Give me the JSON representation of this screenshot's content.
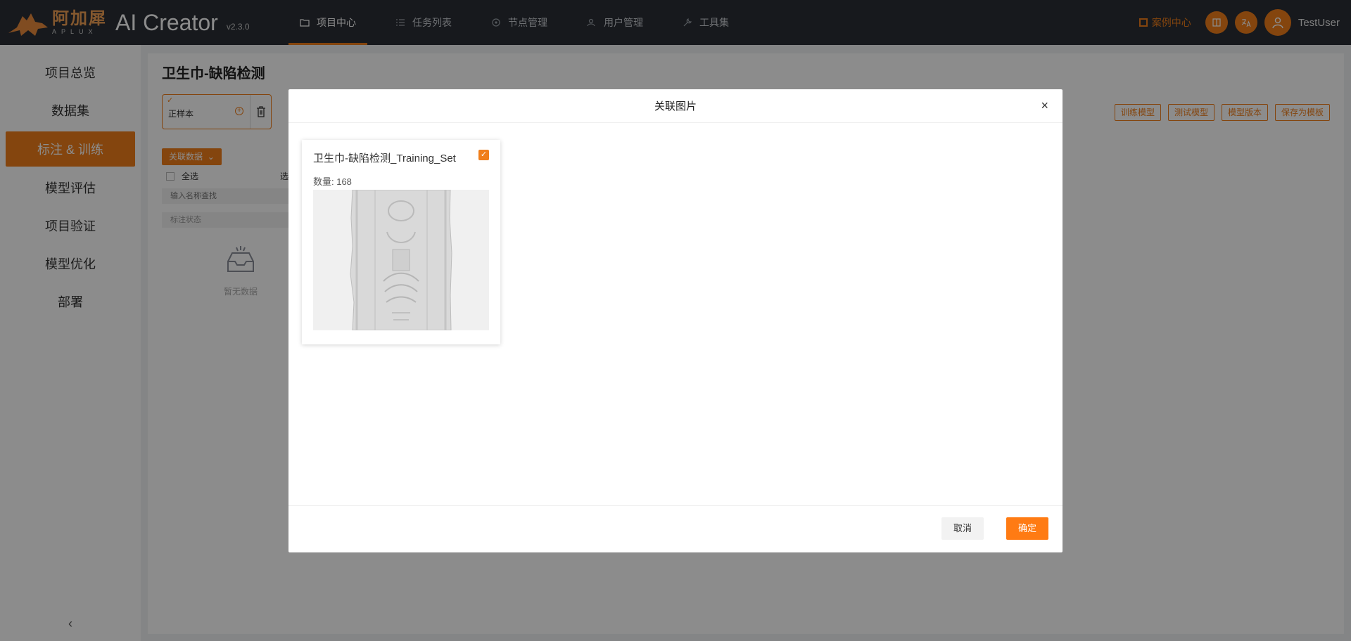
{
  "brand": {
    "cn_name": "阿加犀",
    "en_name": "APLUX",
    "app_name": "AI Creator",
    "version": "v2.3.0",
    "accent_color": "#f07e1a"
  },
  "topnav": {
    "items": [
      {
        "label": "项目中心",
        "icon": "folder-icon",
        "active": true
      },
      {
        "label": "任务列表",
        "icon": "list-icon",
        "active": false
      },
      {
        "label": "节点管理",
        "icon": "node-icon",
        "active": false
      },
      {
        "label": "用户管理",
        "icon": "users-icon",
        "active": false
      },
      {
        "label": "工具集",
        "icon": "wrench-icon",
        "active": false
      }
    ],
    "case_center": "案例中心",
    "username": "TestUser"
  },
  "sidebar": {
    "items": [
      {
        "label": "项目总览"
      },
      {
        "label": "数据集"
      },
      {
        "label": "标注 & 训练",
        "active": true
      },
      {
        "label": "模型评估"
      },
      {
        "label": "项目验证"
      },
      {
        "label": "模型优化"
      },
      {
        "label": "部署"
      }
    ],
    "collapse_glyph": "‹"
  },
  "main": {
    "title": "卫生巾-缺陷检测",
    "sample_label": "正样本",
    "actions": [
      "训练模型",
      "测试模型",
      "模型版本",
      "保存为模板"
    ],
    "link_data_button": "关联数据",
    "select_all": "全选",
    "partial_text": "选",
    "search_placeholder": "输入名称查找",
    "status_placeholder": "标注状态",
    "empty_text": "暂无数据"
  },
  "modal": {
    "title": "关联图片",
    "close_glyph": "×",
    "dataset": {
      "name": "卫生巾-缺陷检测_Training_Set",
      "count_label": "数量: 168",
      "checked": true
    },
    "cancel": "取消",
    "confirm": "确定"
  }
}
